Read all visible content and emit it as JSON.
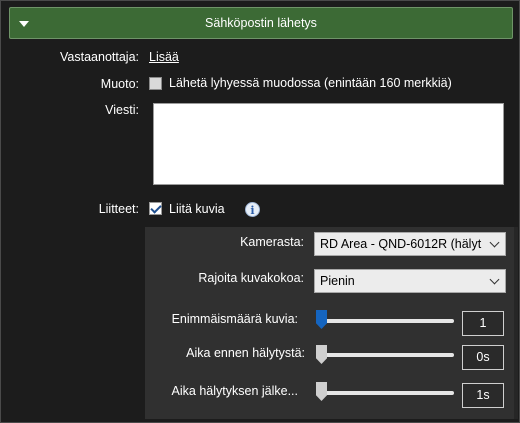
{
  "colors": {
    "header_bg": "#3c6a35",
    "panel_bg": "#1c1c1c",
    "subpanel_bg": "#303030",
    "slider_active": "#1565c0",
    "slider_inactive": "#cfcfcf"
  },
  "header": {
    "title": "Sähköpostin lähetys",
    "toggle_icon": "triangle-down-icon"
  },
  "recipient": {
    "label": "Vastaanottaja:",
    "add_link": "Lisää"
  },
  "format": {
    "label": "Muoto:",
    "checkbox_label": "Lähetä lyhyessä muodossa (enintään 160 merkkiä)",
    "checked": false
  },
  "message": {
    "label": "Viesti:",
    "value": ""
  },
  "attachments": {
    "label": "Liitteet:",
    "checkbox_label": "Liitä kuvia",
    "checked": true,
    "info_icon": "info-icon",
    "info_glyph": "i"
  },
  "camera": {
    "label": "Kamerasta:",
    "value": "RD Area - QND-6012R (hälyt"
  },
  "image_size": {
    "label": "Rajoita kuvakokoa:",
    "value": "Pienin"
  },
  "sliders": [
    {
      "label": "Enimmäismäärä kuvia:",
      "value": "1",
      "level": 0.0
    },
    {
      "label": "Aika ennen hälytystä:",
      "value": "0s",
      "level": 0.0
    },
    {
      "label": "Aika hälytyksen jälke...",
      "value": "1s",
      "level": 0.0
    }
  ]
}
